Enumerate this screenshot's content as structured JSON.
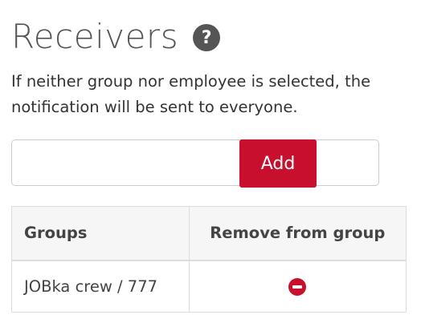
{
  "heading": {
    "title": "Receivers",
    "help_icon": "question-mark-icon",
    "help_glyph": "?"
  },
  "description": {
    "line1": "If neither group nor employee is selected, the",
    "line2": "notification will be sent to everyone."
  },
  "receiver_input": {
    "value": "",
    "placeholder": ""
  },
  "add_button": {
    "label": "Add"
  },
  "table": {
    "headers": [
      "Groups",
      "Remove from group"
    ],
    "rows": [
      {
        "group": "JOBka crew / 777",
        "remove_icon": "minus-circle-icon"
      }
    ]
  },
  "colors": {
    "accent": "#c8102e",
    "heading_text": "#555555",
    "body_text": "#333333",
    "table_header_bg": "#f6f6f6",
    "border": "#dddddd"
  }
}
